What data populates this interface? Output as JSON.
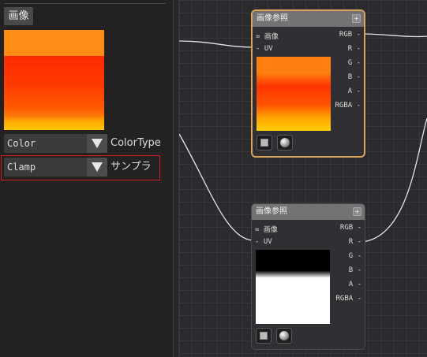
{
  "panel": {
    "tab_label": "画像",
    "color_select": {
      "value": "Color",
      "label": "ColorType"
    },
    "clamp_select": {
      "value": "Clamp",
      "label": "サンプラ"
    }
  },
  "nodes": [
    {
      "title": "画像参照",
      "pin": "+",
      "inputs": [
        "= 画像",
        "- UV"
      ],
      "outputs": [
        "RGB -",
        "R -",
        "G -",
        "B -",
        "A -",
        "RGBA -"
      ]
    },
    {
      "title": "画像参照",
      "pin": "+",
      "inputs": [
        "= 画像",
        "- UV"
      ],
      "outputs": [
        "RGB -",
        "R -",
        "G -",
        "B -",
        "A -",
        "RGBA -"
      ]
    }
  ],
  "colors": {
    "selection_border": "#d9a358",
    "highlight_box": "#d02020",
    "node_header": "#747275"
  },
  "icons": [
    "dropdown-arrow-icon",
    "square-preview-icon",
    "sphere-preview-icon"
  ]
}
